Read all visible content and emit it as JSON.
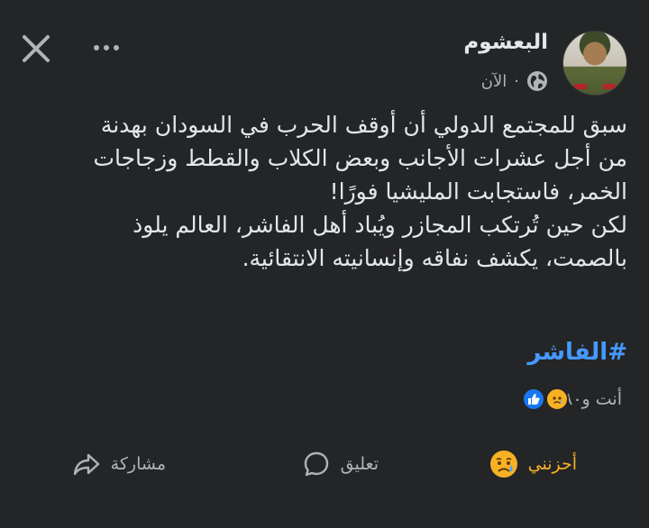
{
  "author": {
    "name": "البعشوم",
    "time": "الآن",
    "separator": "·"
  },
  "post": {
    "lines": [
      "سبق للمجتمع الدولي أن أوقف الحرب في السودان بهدنة",
      "من أجل عشرات الأجانب وبعض الكلاب والقطط وزجاجات",
      "الخمر، فاستجابت المليشيا فورًا!",
      "لكن حين تُرتكب المجازر ويُباد أهل الفاشر، العالم يلوذ",
      "بالصمت، يكشف نفاقه وإنسانيته الانتقائية."
    ],
    "hashtag": "#الفاشر"
  },
  "reactions": {
    "summary": "أنت و٨٠",
    "types": [
      "like-icon",
      "sad-icon"
    ]
  },
  "actions": {
    "react_label": "أحزنني",
    "comment_label": "تعليق",
    "share_label": "مشاركة"
  },
  "icons": {
    "close": "close-icon",
    "more": "more-options-icon",
    "globe": "globe-icon",
    "comment": "comment-icon",
    "share": "share-icon"
  },
  "colors": {
    "background": "#242526",
    "text": "#e4e6eb",
    "muted": "#b0b3b8",
    "hashtag": "#4599ff",
    "sad_reaction": "#f7b125",
    "like_reaction": "#1877f2"
  }
}
